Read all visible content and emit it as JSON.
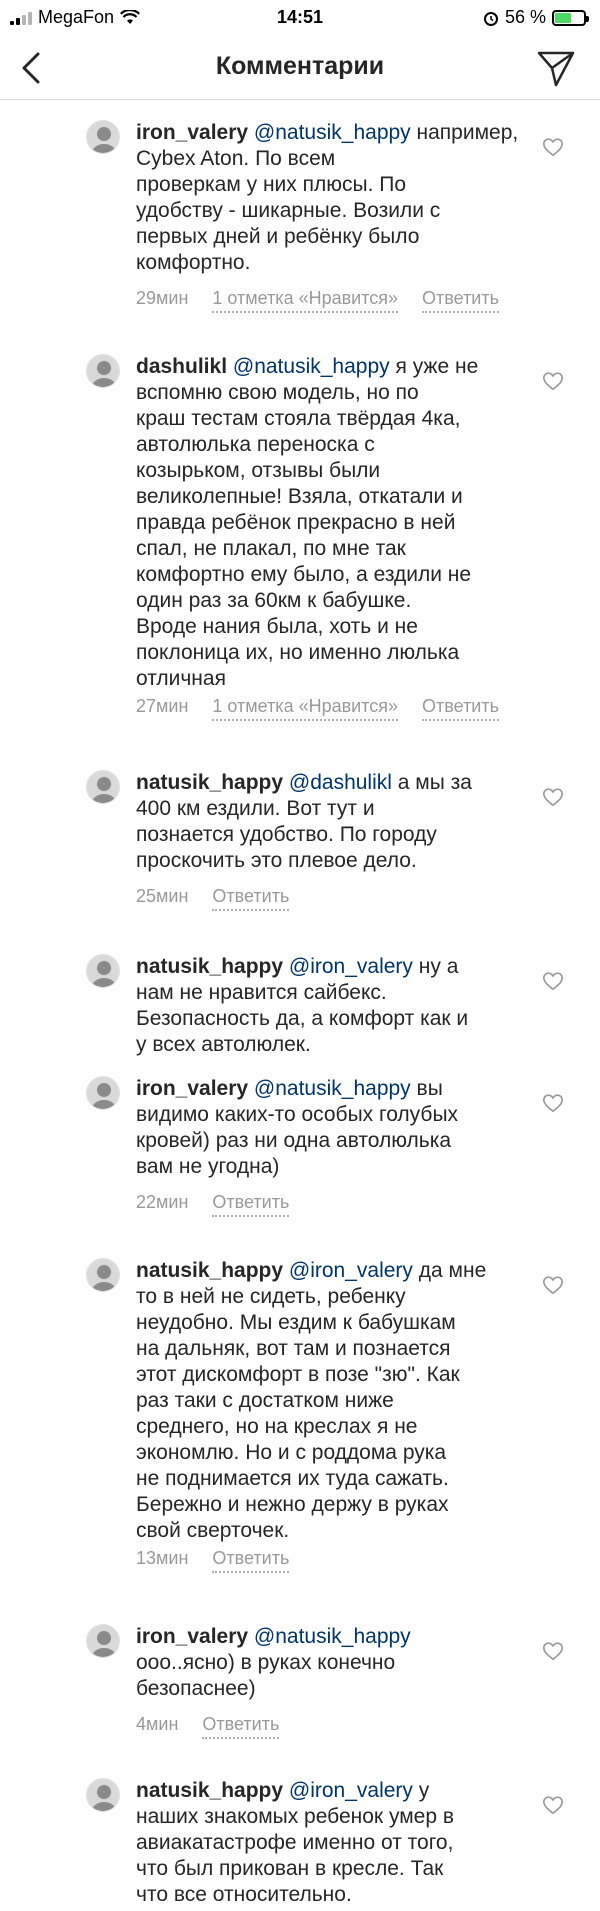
{
  "status": {
    "carrier": "MegaFon",
    "time": "14:51",
    "battery": "56 %",
    "battery_level": 0.56
  },
  "header": {
    "title": "Комментарии"
  },
  "icons": {
    "back": "chevron-left-icon",
    "send": "paper-plane-icon",
    "like": "heart-outline-icon"
  },
  "comments": [
    {
      "user": "iron_valery",
      "mention": "@natusik_happy",
      "text": "например, Cybex Aton.  По всем\nпроверкам у них плюсы. По\nудобству - шикарные. Возили с\nпервых дней и ребёнку было\nкомфортно.",
      "time": "29мин",
      "likes": "1 отметка «Нравится»",
      "reply": "Ответить"
    },
    {
      "user": "dashulikl",
      "mention": "@natusik_happy",
      "text": "я уже не\nвспомню свою модель, но по\nкраш тестам стояла твёрдая 4ка,\nавтолюлька переноска с\nкозырьком, отзывы были\nвеликолепные! Взяла, откатали и\nправда ребёнок прекрасно в ней\nспал, не плакал, по мне так\nкомфортно ему было, а ездили не\nодин раз за 60км к бабушке.\nВроде нания была, хоть и не\nпоклоница их, но именно люлька\nотличная",
      "time": "27мин",
      "likes": "1 отметка «Нравится»",
      "reply": "Ответить"
    },
    {
      "user": "natusik_happy",
      "mention": "@dashulikl",
      "text": "а мы за\n400 км ездили. Вот тут и\nпознается удобство. По городу\nпроскочить это плевое дело.",
      "time": "25мин",
      "likes": "",
      "reply": "Ответить"
    },
    {
      "user": "natusik_happy",
      "mention": "@iron_valery",
      "text": "ну а\nнам не нравится сайбекс.\nБезопасность да, а комфорт как и\nу всех автолюлек.",
      "time": "",
      "likes": "",
      "reply": ""
    },
    {
      "user": "iron_valery",
      "mention": "@natusik_happy",
      "text": "вы\nвидимо каких-то особых голубых\nкровей) раз ни одна автолюлька\nвам не угодна)",
      "time": "22мин",
      "likes": "",
      "reply": "Ответить"
    },
    {
      "user": "natusik_happy",
      "mention": "@iron_valery",
      "text": "да мне\nто в ней не сидеть, ребенку\nнеудобно. Мы ездим к бабушкам\nна дальняк, вот там и познается\nэтот дискомфорт в позе \"зю\". Как\nраз таки с достатком ниже\nсреднего, но на креслах я не\nэкономлю. Но и с роддома рука\nне поднимается их туда сажать.\nБережно и нежно держу в руках\nсвой сверточек.",
      "time": "13мин",
      "likes": "",
      "reply": "Ответить"
    },
    {
      "user": "iron_valery",
      "mention": "@natusik_happy",
      "text": "\nооо..ясно) в руках конечно\nбезопаснее)",
      "time": "4мин",
      "likes": "",
      "reply": "Ответить"
    },
    {
      "user": "natusik_happy",
      "mention": "@iron_valery",
      "text": "у\nнаших знакомых ребенок умер в\nавиакатастрофе именно от того,\nчто был прикован в кресле. Так\nчто все относительно.",
      "time": "",
      "likes": "",
      "reply": ""
    }
  ]
}
